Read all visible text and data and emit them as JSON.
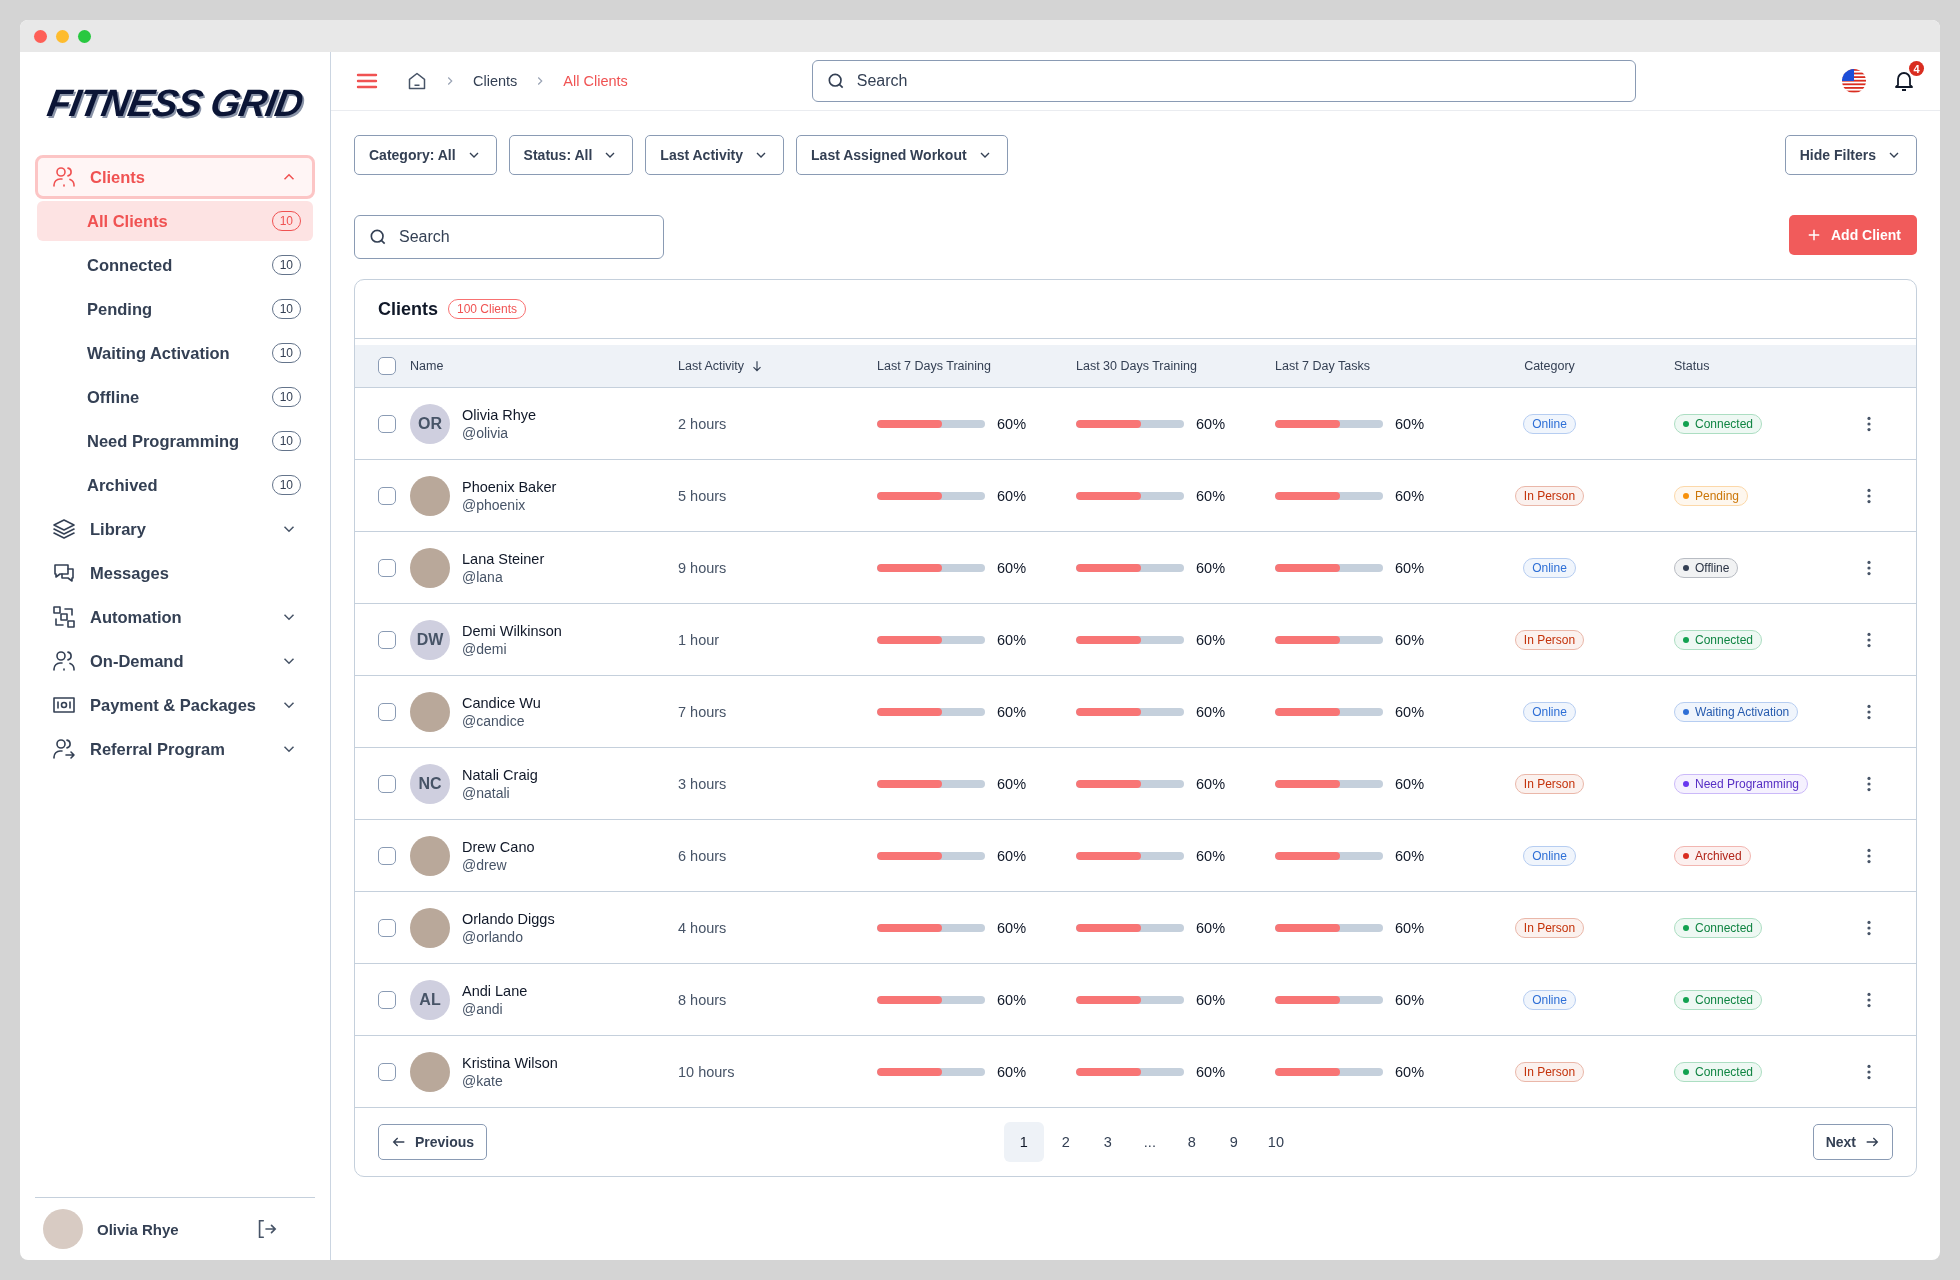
{
  "logo": "FITNESS GRID",
  "sidebar": {
    "items": [
      {
        "label": "Clients",
        "kind": "group",
        "expanded": true,
        "selected": true,
        "children": [
          {
            "label": "All Clients",
            "count": "10",
            "selected": true
          },
          {
            "label": "Connected",
            "count": "10",
            "selected": false
          },
          {
            "label": "Pending",
            "count": "10",
            "selected": false
          },
          {
            "label": "Waiting Activation",
            "count": "10",
            "selected": false
          },
          {
            "label": "Offline",
            "count": "10",
            "selected": false
          },
          {
            "label": "Need Programming",
            "count": "10",
            "selected": false
          },
          {
            "label": "Archived",
            "count": "10",
            "selected": false
          }
        ]
      },
      {
        "label": "Library",
        "kind": "group",
        "expanded": false,
        "selected": false
      },
      {
        "label": "Messages",
        "kind": "link",
        "selected": false
      },
      {
        "label": "Automation",
        "kind": "group",
        "expanded": false,
        "selected": false
      },
      {
        "label": "On-Demand",
        "kind": "group",
        "expanded": false,
        "selected": false
      },
      {
        "label": "Payment & Packages",
        "kind": "group",
        "expanded": false,
        "selected": false
      },
      {
        "label": "Referral Program",
        "kind": "group",
        "expanded": false,
        "selected": false
      }
    ],
    "user": {
      "name": "Olivia Rhye"
    }
  },
  "breadcrumb": [
    {
      "label": "Clients",
      "selected": false
    },
    {
      "label": "All Clients",
      "selected": true
    }
  ],
  "top_search": {
    "placeholder": "Search"
  },
  "notifications": {
    "count": "4"
  },
  "filters": [
    "Category: All",
    "Status: All",
    "Last Activity",
    "Last Assigned Workout"
  ],
  "hide_filters": "Hide Filters",
  "client_search": {
    "placeholder": "Search"
  },
  "add_button": "Add Client",
  "table": {
    "title": "Clients",
    "badge": "100 Clients",
    "all_checked": false,
    "columns": [
      {
        "label": "Name",
        "sorted": false
      },
      {
        "label": "Last Activity",
        "sorted": true
      },
      {
        "label": "Last 7 Days Training",
        "sorted": false
      },
      {
        "label": "Last 30 Days Training",
        "sorted": false
      },
      {
        "label": "Last 7 Day Tasks",
        "sorted": false
      },
      {
        "label": "Category",
        "sorted": false
      },
      {
        "label": "Status",
        "sorted": false
      }
    ],
    "rows": [
      {
        "checked": false,
        "avatar": {
          "kind": "initials",
          "text": "OR"
        },
        "name": "Olivia Rhye",
        "handle": "@olivia",
        "last_activity": "2 hours",
        "metrics": [
          {
            "level": 0.6,
            "reading": "60%"
          },
          {
            "level": 0.6,
            "reading": "60%"
          },
          {
            "level": 0.6,
            "reading": "60%"
          }
        ],
        "category": {
          "label": "Online",
          "color": "#2e6fd6"
        },
        "status": {
          "label": "Connected",
          "color": "#12a150"
        }
      },
      {
        "checked": false,
        "avatar": {
          "kind": "photo"
        },
        "name": "Phoenix Baker",
        "handle": "@phoenix",
        "last_activity": "5 hours",
        "metrics": [
          {
            "level": 0.6,
            "reading": "60%"
          },
          {
            "level": 0.6,
            "reading": "60%"
          },
          {
            "level": 0.6,
            "reading": "60%"
          }
        ],
        "category": {
          "label": "In Person",
          "color": "#c4320a"
        },
        "status": {
          "label": "Pending",
          "color": "#f79009"
        }
      },
      {
        "checked": false,
        "avatar": {
          "kind": "photo"
        },
        "name": "Lana Steiner",
        "handle": "@lana",
        "last_activity": "9 hours",
        "metrics": [
          {
            "level": 0.6,
            "reading": "60%"
          },
          {
            "level": 0.6,
            "reading": "60%"
          },
          {
            "level": 0.6,
            "reading": "60%"
          }
        ],
        "category": {
          "label": "Online",
          "color": "#2e6fd6"
        },
        "status": {
          "label": "Offline",
          "color": "#344054"
        }
      },
      {
        "checked": false,
        "avatar": {
          "kind": "initials",
          "text": "DW"
        },
        "name": "Demi Wilkinson",
        "handle": "@demi",
        "last_activity": "1 hour",
        "metrics": [
          {
            "level": 0.6,
            "reading": "60%"
          },
          {
            "level": 0.6,
            "reading": "60%"
          },
          {
            "level": 0.6,
            "reading": "60%"
          }
        ],
        "category": {
          "label": "In Person",
          "color": "#c4320a"
        },
        "status": {
          "label": "Connected",
          "color": "#12a150"
        }
      },
      {
        "checked": false,
        "avatar": {
          "kind": "photo"
        },
        "name": "Candice Wu",
        "handle": "@candice",
        "last_activity": "7 hours",
        "metrics": [
          {
            "level": 0.6,
            "reading": "60%"
          },
          {
            "level": 0.6,
            "reading": "60%"
          },
          {
            "level": 0.6,
            "reading": "60%"
          }
        ],
        "category": {
          "label": "Online",
          "color": "#2e6fd6"
        },
        "status": {
          "label": "Waiting Activation",
          "color": "#2e6fd6"
        }
      },
      {
        "checked": false,
        "avatar": {
          "kind": "initials",
          "text": "NC"
        },
        "name": "Natali Craig",
        "handle": "@natali",
        "last_activity": "3 hours",
        "metrics": [
          {
            "level": 0.6,
            "reading": "60%"
          },
          {
            "level": 0.6,
            "reading": "60%"
          },
          {
            "level": 0.6,
            "reading": "60%"
          }
        ],
        "category": {
          "label": "In Person",
          "color": "#c4320a"
        },
        "status": {
          "label": "Need Programming",
          "color": "#6938ef"
        }
      },
      {
        "checked": false,
        "avatar": {
          "kind": "photo"
        },
        "name": "Drew Cano",
        "handle": "@drew",
        "last_activity": "6 hours",
        "metrics": [
          {
            "level": 0.6,
            "reading": "60%"
          },
          {
            "level": 0.6,
            "reading": "60%"
          },
          {
            "level": 0.6,
            "reading": "60%"
          }
        ],
        "category": {
          "label": "Online",
          "color": "#2e6fd6"
        },
        "status": {
          "label": "Archived",
          "color": "#d92d20"
        }
      },
      {
        "checked": false,
        "avatar": {
          "kind": "photo"
        },
        "name": "Orlando Diggs",
        "handle": "@orlando",
        "last_activity": "4 hours",
        "metrics": [
          {
            "level": 0.6,
            "reading": "60%"
          },
          {
            "level": 0.6,
            "reading": "60%"
          },
          {
            "level": 0.6,
            "reading": "60%"
          }
        ],
        "category": {
          "label": "In Person",
          "color": "#c4320a"
        },
        "status": {
          "label": "Connected",
          "color": "#12a150"
        }
      },
      {
        "checked": false,
        "avatar": {
          "kind": "initials",
          "text": "AL"
        },
        "name": "Andi Lane",
        "handle": "@andi",
        "last_activity": "8 hours",
        "metrics": [
          {
            "level": 0.6,
            "reading": "60%"
          },
          {
            "level": 0.6,
            "reading": "60%"
          },
          {
            "level": 0.6,
            "reading": "60%"
          }
        ],
        "category": {
          "label": "Online",
          "color": "#2e6fd6"
        },
        "status": {
          "label": "Connected",
          "color": "#12a150"
        }
      },
      {
        "checked": false,
        "avatar": {
          "kind": "photo"
        },
        "name": "Kristina Wilson",
        "handle": "@kate",
        "last_activity": "10 hours",
        "metrics": [
          {
            "level": 0.6,
            "reading": "60%"
          },
          {
            "level": 0.6,
            "reading": "60%"
          },
          {
            "level": 0.6,
            "reading": "60%"
          }
        ],
        "category": {
          "label": "In Person",
          "color": "#c4320a"
        },
        "status": {
          "label": "Connected",
          "color": "#12a150"
        }
      }
    ]
  },
  "pagination": {
    "previous": "Previous",
    "next": "Next",
    "pages": [
      {
        "label": "1",
        "selected": true
      },
      {
        "label": "2",
        "selected": false
      },
      {
        "label": "3",
        "selected": false
      },
      {
        "label": "...",
        "selected": false
      },
      {
        "label": "8",
        "selected": false
      },
      {
        "label": "9",
        "selected": false
      },
      {
        "label": "10",
        "selected": false
      }
    ]
  }
}
